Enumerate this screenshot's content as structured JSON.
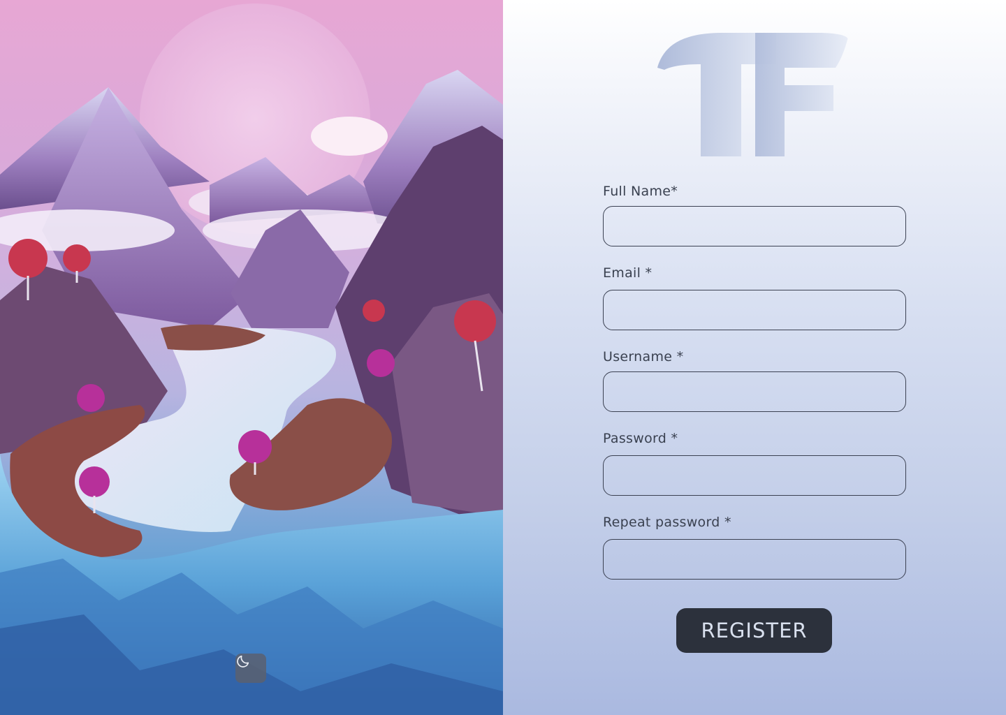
{
  "illustration": {
    "alt": "fantasy mountain landscape with river"
  },
  "theme_toggle": {
    "icon": "moon-icon"
  },
  "logo": {
    "text": "TF"
  },
  "form": {
    "fields": [
      {
        "label": "Full Name*",
        "value": "",
        "type": "text"
      },
      {
        "label": "Email *",
        "value": "",
        "type": "email"
      },
      {
        "label": "Username *",
        "value": "",
        "type": "text"
      },
      {
        "label": "Password *",
        "value": "",
        "type": "password"
      },
      {
        "label": "Repeat password *",
        "value": "",
        "type": "password"
      }
    ],
    "submit_label": "REGISTER"
  },
  "colors": {
    "button_bg": "#2c313c",
    "input_border": "#3b4152",
    "logo": "#b9c3de"
  }
}
